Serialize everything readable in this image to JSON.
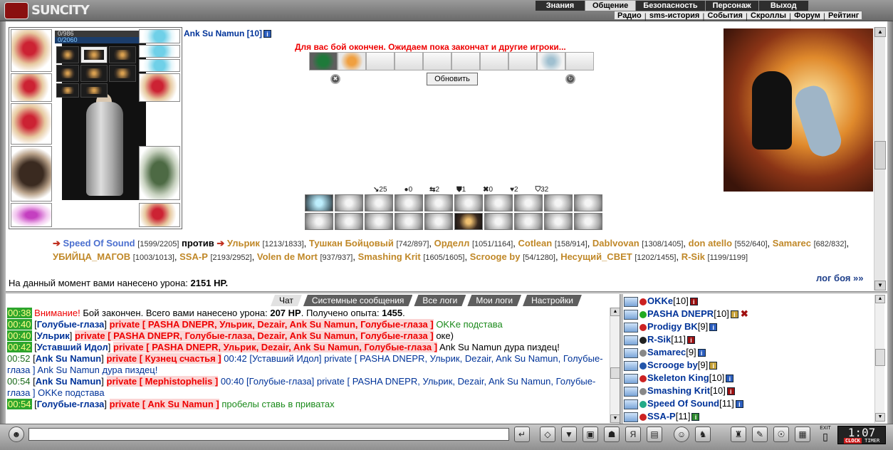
{
  "app": {
    "logo": "SUNCITY"
  },
  "top_menu": {
    "primary": [
      "Знания",
      "Общение",
      "Безопасность",
      "Персонаж",
      "Выход"
    ],
    "primary_active": "Общение",
    "secondary": [
      "Радио",
      "sms-история",
      "События",
      "Скроллы",
      "Форум",
      "Рейтинг"
    ]
  },
  "character": {
    "name": "Ank Su Namun [10]",
    "hp": "0/986",
    "mana": "0/2060"
  },
  "battle": {
    "message": "Для вас бой окончен. Ожидаем пока закончат и другие игроки...",
    "refresh_label": "Обновить",
    "stats": [
      "25",
      "0",
      "2",
      "1",
      "0",
      "2",
      "32"
    ],
    "vs_label": "против",
    "team1": [
      {
        "name": "Speed Of Sound",
        "hp": "[1599/2205]"
      }
    ],
    "team2": [
      {
        "name": "Ульрик",
        "hp": "[1213/1833]"
      },
      {
        "name": "Тушкан Бойцовый",
        "hp": "[742/897]"
      },
      {
        "name": "Орделл",
        "hp": "[1051/1164]"
      },
      {
        "name": "Cotlean",
        "hp": "[158/914]"
      },
      {
        "name": "Dablvovan",
        "hp": "[1308/1405]"
      },
      {
        "name": "don atello",
        "hp": "[552/640]"
      },
      {
        "name": "Samarec",
        "hp": "[682/832]"
      },
      {
        "name": "УБИЙЦА_МАГОВ",
        "hp": "[1003/1013]"
      },
      {
        "name": "SSA-P",
        "hp": "[2193/2952]"
      },
      {
        "name": "Volen de Mort",
        "hp": "[937/937]"
      },
      {
        "name": "Smashing Krit",
        "hp": "[1605/1605]"
      },
      {
        "name": "Scrooge by",
        "hp": "[54/1280]"
      },
      {
        "name": "Несущий_СВЕТ",
        "hp": "[1202/1455]"
      },
      {
        "name": "R-Sik",
        "hp": "[1199/1199]"
      }
    ],
    "damage_label": "На данный момент вами нанесено урона:",
    "damage_value": "2151 HP.",
    "log_link": "лог боя »»"
  },
  "chat": {
    "tabs": [
      "Чат",
      "Системные сообщения",
      "Все логи",
      "Мои логи",
      "Настройки"
    ],
    "active_tab": "Чат",
    "messages": [
      {
        "time": "00:38",
        "hl": true,
        "warn": "Внимание!",
        "text": " Бой закончен. Всего вами нанесено урона: ",
        "b1": "207 HP",
        "text2": ". Получено опыта: ",
        "b2": "1455",
        "text3": "."
      },
      {
        "time": "00:40",
        "hl": true,
        "from": "Голубые-глаза",
        "priv": "private [ PASHA DNEPR, Ульрик, Dezair, Ank Su Namun, Голубые-глаза ]",
        "body": "OKKe подстава",
        "body_cls": "gr"
      },
      {
        "time": "00:40",
        "hl": true,
        "from": "Ульрик",
        "priv": "private [ PASHA DNEPR, Голубые-глаза, Dezair, Ank Su Namun, Голубые-глаза ]",
        "body": "оке)",
        "body_cls": ""
      },
      {
        "time": "00:42",
        "hl": true,
        "from": "Уставший Идол",
        "priv": "private [ PASHA DNEPR, Ульрик, Dezair, Ank Su Namun, Голубые-глаза ]",
        "body": "Ank Su Namun дура пиздец!",
        "body_cls": ""
      },
      {
        "time": "00:52",
        "hl": false,
        "from": "Ank Su Namun",
        "priv": "private [ Кузнец счастья ]",
        "body": "00:42 [Уставший Идол] private [ PASHA DNEPR, Ульрик, Dezair, Ank Su Namun, Голубые-глаза ] Ank Su Namun дура пиздец!",
        "body_cls": "bl"
      },
      {
        "time": "00:54",
        "hl": false,
        "from": "Ank Su Namun",
        "priv": "private [ Mephistophelis ]",
        "body": "00:40 [Голубые-глаза] private [ PASHA DNEPR, Ульрик, Dezair, Ank Su Namun, Голубые-глаза ] OKKe подстава",
        "body_cls": "bl"
      },
      {
        "time": "00:54",
        "hl": true,
        "from": "Голубые-глаза",
        "priv": "private [ Ank Su Namun ]",
        "body": "пробелы ставь в приватах",
        "body_cls": "gr"
      }
    ]
  },
  "users": [
    {
      "name": "OKKe",
      "level": "[10]",
      "info": "red",
      "mark": ""
    },
    {
      "name": "PASHA DNEPR",
      "level": "[10]",
      "info": "yel",
      "mark": "✖"
    },
    {
      "name": "Prodigy BK",
      "level": "[9]",
      "info": "blue",
      "mark": ""
    },
    {
      "name": "R-Sik",
      "level": "[11]",
      "info": "red",
      "mark": ""
    },
    {
      "name": "Samarec",
      "level": "[9]",
      "info": "blue",
      "mark": ""
    },
    {
      "name": "Scrooge by",
      "level": "[9]",
      "info": "yel",
      "mark": ""
    },
    {
      "name": "Skeleton King",
      "level": "[10]",
      "info": "blue",
      "mark": ""
    },
    {
      "name": "Smashing Krit",
      "level": "[10]",
      "info": "red",
      "mark": ""
    },
    {
      "name": "Speed Of Sound",
      "level": "[11]",
      "info": "blue",
      "mark": ""
    },
    {
      "name": "SSA-P",
      "level": "[11]",
      "info": "grn",
      "mark": ""
    }
  ],
  "bottom": {
    "clock": "1:07",
    "clock_labels": [
      "CLOCK",
      "TIMER"
    ],
    "exit_label": "EXIT"
  },
  "colors": {
    "accent_name": "#003399",
    "fighter_name": "#c08828",
    "private": "#ee0000",
    "timestamp_bg": "#2da52d"
  }
}
